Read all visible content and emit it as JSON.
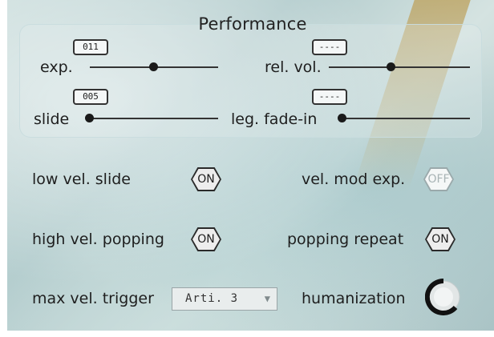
{
  "panel": {
    "title": "Performance",
    "sliders": [
      {
        "label": "exp.",
        "value_display": "011"
      },
      {
        "label": "rel. vol.",
        "value_display": "----"
      },
      {
        "label": "slide",
        "value_display": "005"
      },
      {
        "label": "leg. fade-in",
        "value_display": "----"
      }
    ],
    "toggles": [
      {
        "label": "low vel. slide",
        "state": "ON"
      },
      {
        "label": "vel. mod exp.",
        "state": "OFF"
      },
      {
        "label": "high vel. popping",
        "state": "ON"
      },
      {
        "label": "popping repeat",
        "state": "ON"
      }
    ],
    "max_vel_trigger": {
      "label": "max vel. trigger",
      "selected": "Arti. 3",
      "icon": "dropdown-arrow-icon"
    },
    "humanization": {
      "label": "humanization",
      "icon": "dial-knob-icon"
    }
  }
}
